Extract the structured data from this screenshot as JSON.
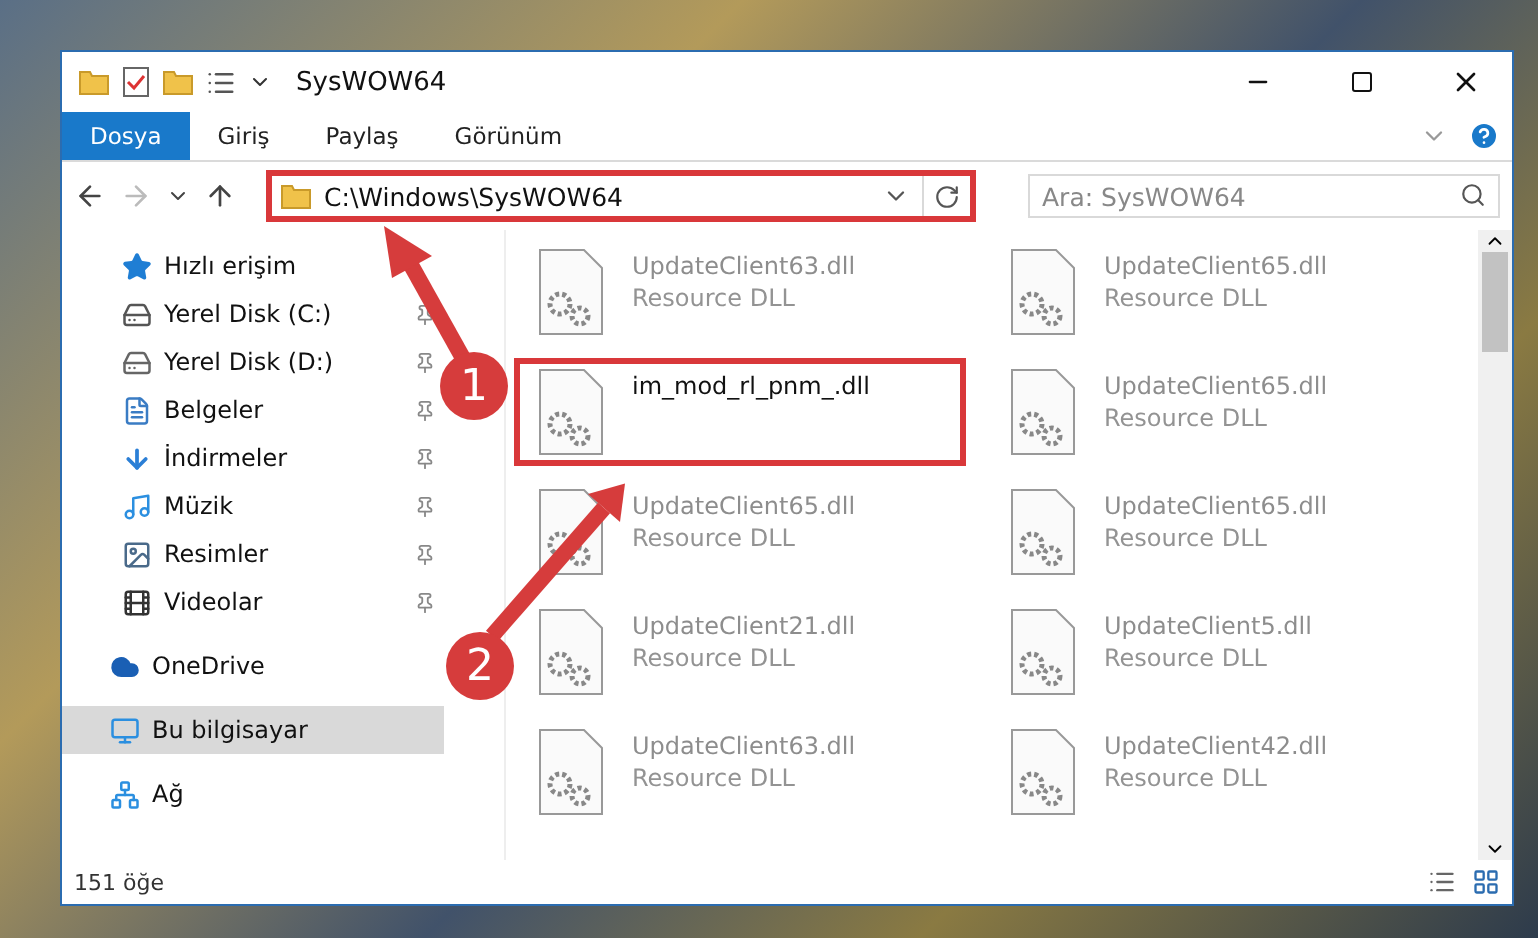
{
  "window": {
    "title": "SysWOW64"
  },
  "ribbon_tabs": [
    {
      "label": "Dosya",
      "selected": true
    },
    {
      "label": "Giriş",
      "selected": false
    },
    {
      "label": "Paylaş",
      "selected": false
    },
    {
      "label": "Görünüm",
      "selected": false
    }
  ],
  "address_bar": {
    "path": "C:\\Windows\\SysWOW64",
    "highlighted": true
  },
  "search": {
    "placeholder": "Ara: SysWOW64"
  },
  "sidebar": {
    "items": [
      {
        "label": "Hızlı erişim",
        "kind": "star",
        "pinned": false,
        "selected": false,
        "group_start": false
      },
      {
        "label": "Yerel Disk (C:)",
        "kind": "system-drive",
        "pinned": true,
        "selected": false,
        "group_start": false
      },
      {
        "label": "Yerel Disk (D:)",
        "kind": "drive",
        "pinned": true,
        "selected": false,
        "group_start": false
      },
      {
        "label": "Belgeler",
        "kind": "documents",
        "pinned": true,
        "selected": false,
        "group_start": false
      },
      {
        "label": "İndirmeler",
        "kind": "downloads",
        "pinned": true,
        "selected": false,
        "group_start": false
      },
      {
        "label": "Müzik",
        "kind": "music",
        "pinned": true,
        "selected": false,
        "group_start": false
      },
      {
        "label": "Resimler",
        "kind": "pictures",
        "pinned": true,
        "selected": false,
        "group_start": false
      },
      {
        "label": "Videolar",
        "kind": "videos",
        "pinned": true,
        "selected": false,
        "group_start": false
      },
      {
        "label": "OneDrive",
        "kind": "cloud",
        "pinned": false,
        "selected": false,
        "group_start": true
      },
      {
        "label": "Bu bilgisayar",
        "kind": "computer",
        "pinned": false,
        "selected": true,
        "group_start": true
      },
      {
        "label": "Ağ",
        "kind": "network",
        "pinned": false,
        "selected": false,
        "group_start": true
      }
    ]
  },
  "files": [
    {
      "name": "UpdateClient63.dll",
      "type": "Resource DLL",
      "faded": true,
      "highlighted": false
    },
    {
      "name": "UpdateClient65.dll",
      "type": "Resource DLL",
      "faded": true,
      "highlighted": false
    },
    {
      "name": "im_mod_rl_pnm_.dll",
      "faded": false,
      "highlighted": true
    },
    {
      "name": "UpdateClient65.dll",
      "type": "Resource DLL",
      "faded": true,
      "highlighted": false
    },
    {
      "name": "UpdateClient65.dll",
      "type": "Resource DLL",
      "faded": true,
      "highlighted": false
    },
    {
      "name": "UpdateClient65.dll",
      "type": "Resource DLL",
      "faded": true,
      "highlighted": false
    },
    {
      "name": "UpdateClient21.dll",
      "type": "Resource DLL",
      "faded": true,
      "highlighted": false
    },
    {
      "name": "UpdateClient5.dll",
      "type": "Resource DLL",
      "faded": true,
      "highlighted": false
    },
    {
      "name": "UpdateClient63.dll",
      "type": "Resource DLL",
      "faded": true,
      "highlighted": false
    },
    {
      "name": "UpdateClient42.dll",
      "type": "Resource DLL",
      "faded": true,
      "highlighted": false
    }
  ],
  "status_bar": {
    "count": "151 öğe"
  },
  "callouts": [
    {
      "number": "1"
    },
    {
      "number": "2"
    }
  ]
}
